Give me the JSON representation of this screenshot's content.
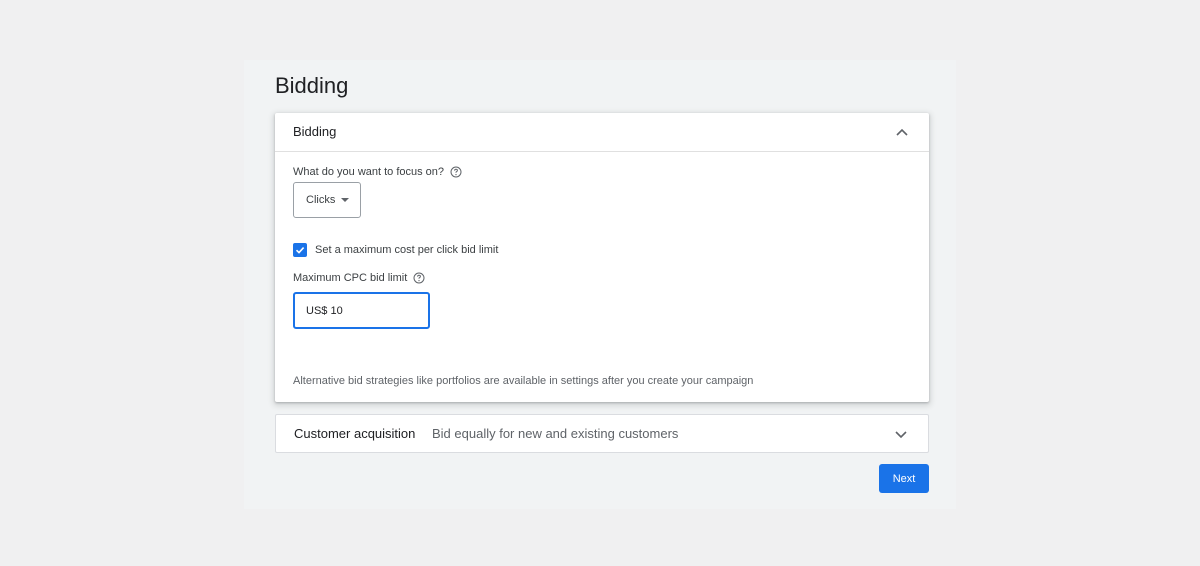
{
  "page": {
    "title": "Bidding"
  },
  "bidding_card": {
    "header_title": "Bidding",
    "focus_label": "What do you want to focus on?",
    "focus_select": {
      "selected": "Clicks"
    },
    "max_cpc_checkbox": {
      "checked": true,
      "label": "Set a maximum cost per click bid limit"
    },
    "max_cpc_label": "Maximum CPC bid limit",
    "max_cpc_input": {
      "value": "US$ 10"
    },
    "footnote": "Alternative bid strategies like portfolios are available in settings after you create your campaign"
  },
  "customer_card": {
    "title": "Customer acquisition",
    "summary": "Bid equally for new and existing customers"
  },
  "actions": {
    "next_label": "Next"
  },
  "icons": {
    "collapse": "chevron-up-icon",
    "expand": "chevron-down-icon",
    "help": "help-circle-icon",
    "check": "check-icon"
  },
  "colors": {
    "accent": "#1a73e8",
    "page_background": "#f0f0f1",
    "panel_background": "#f1f3f4"
  }
}
